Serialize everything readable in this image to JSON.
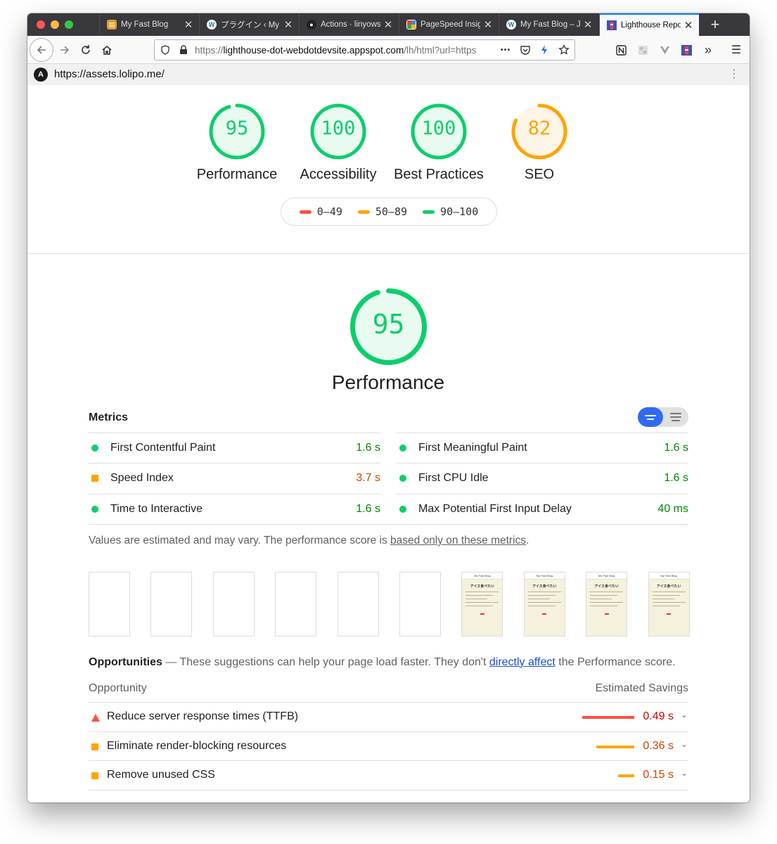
{
  "browser": {
    "tabs": [
      {
        "label": "My Fast Blog",
        "favicon": "notebook-icon",
        "active": false
      },
      {
        "label": "プラグイン ‹ My Fast Blog",
        "favicon": "wordpress-icon",
        "active": false
      },
      {
        "label": "Actions · linyows",
        "favicon": "github-icon",
        "active": false
      },
      {
        "label": "PageSpeed Insights",
        "favicon": "pagespeed-icon",
        "active": false
      },
      {
        "label": "My Fast Blog – Just",
        "favicon": "wordpress-icon",
        "active": false
      },
      {
        "label": "Lighthouse Report",
        "favicon": "lighthouse-icon",
        "active": true
      }
    ],
    "new_tab_label": "+",
    "url_prefix": "https://",
    "url_host": "lighthouse-dot-webdotdevsite.appspot.com",
    "url_path": "/lh/html?url=https",
    "more_label": "•••",
    "menu_label": "☰",
    "overflow_label": "»"
  },
  "site_bar": {
    "url": "https://assets.lolipo.me/",
    "logo_label": "A"
  },
  "colors": {
    "pass": "#0cce6b",
    "average": "#ffa400",
    "fail": "#ff4e42",
    "accent": "#0a84ff",
    "toggle_active": "#2f6bf5"
  },
  "summary": {
    "gauges": [
      {
        "score": "95",
        "label": "Performance",
        "status": "pass"
      },
      {
        "score": "100",
        "label": "Accessibility",
        "status": "pass"
      },
      {
        "score": "100",
        "label": "Best Practices",
        "status": "pass"
      },
      {
        "score": "82",
        "label": "SEO",
        "status": "average"
      }
    ],
    "legend": [
      {
        "label": "0–49",
        "status": "fail"
      },
      {
        "label": "50–89",
        "status": "average"
      },
      {
        "label": "90–100",
        "status": "pass"
      }
    ]
  },
  "performance": {
    "score": "95",
    "title": "Performance",
    "metrics_title": "Metrics",
    "metrics": [
      {
        "label": "First Contentful Paint",
        "value": "1.6 s",
        "status": "pass"
      },
      {
        "label": "First Meaningful Paint",
        "value": "1.6 s",
        "status": "pass"
      },
      {
        "label": "Speed Index",
        "value": "3.7 s",
        "status": "average"
      },
      {
        "label": "First CPU Idle",
        "value": "1.6 s",
        "status": "pass"
      },
      {
        "label": "Time to Interactive",
        "value": "1.6 s",
        "status": "pass"
      },
      {
        "label": "Max Potential First Input Delay",
        "value": "40 ms",
        "status": "pass"
      }
    ],
    "note_prefix": "Values are estimated and may vary. The performance score is ",
    "note_link": "based only on these metrics",
    "note_suffix": ".",
    "filmstrip": {
      "frames": [
        {
          "filled": false
        },
        {
          "filled": false
        },
        {
          "filled": false
        },
        {
          "filled": false
        },
        {
          "filled": false
        },
        {
          "filled": false
        },
        {
          "filled": true
        },
        {
          "filled": true
        },
        {
          "filled": true
        },
        {
          "filled": true
        }
      ],
      "frame_header": "My Fast Blog",
      "frame_title": "アイス食べたい"
    }
  },
  "opportunities": {
    "title": "Opportunities",
    "desc_prefix": " — These suggestions can help your page load faster. They don't ",
    "desc_link": "directly affect",
    "desc_suffix": " the Performance score.",
    "col_left": "Opportunity",
    "col_right": "Estimated Savings",
    "items": [
      {
        "label": "Reduce server response times (TTFB)",
        "savings": "0.49 s",
        "seconds": 0.49,
        "status": "fail"
      },
      {
        "label": "Eliminate render-blocking resources",
        "savings": "0.36 s",
        "seconds": 0.36,
        "status": "average"
      },
      {
        "label": "Remove unused CSS",
        "savings": "0.15 s",
        "seconds": 0.15,
        "status": "average"
      }
    ]
  }
}
